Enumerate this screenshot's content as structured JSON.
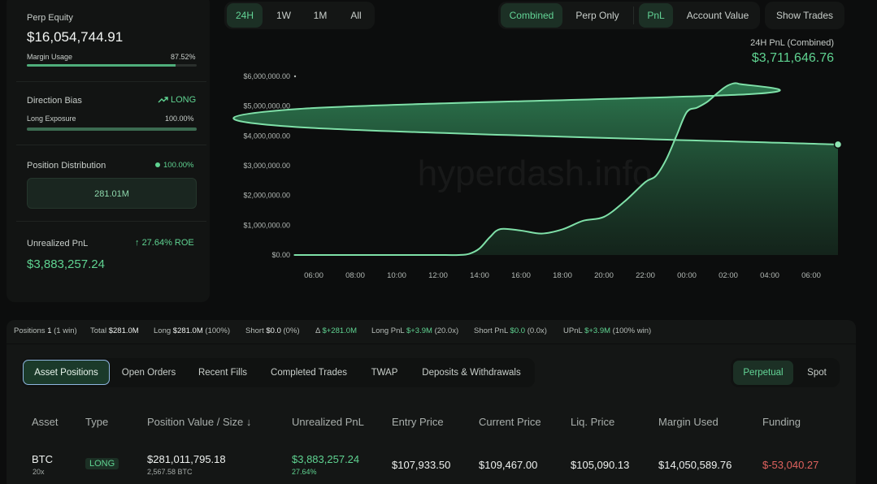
{
  "summary": {
    "perp_equity_label": "Perp Equity",
    "perp_equity_value": "$16,054,744.91",
    "margin_usage_label": "Margin Usage",
    "margin_usage_value": "87.52%",
    "margin_usage_fraction": 0.8752,
    "direction_bias_label": "Direction Bias",
    "direction_bias_value": "LONG",
    "long_exposure_label": "Long Exposure",
    "long_exposure_value": "100.00%",
    "long_exposure_fraction": 1.0,
    "position_distribution_label": "Position Distribution",
    "position_distribution_value": "100.00%",
    "position_distribution_amount": "281.01M",
    "unrealized_pnl_label": "Unrealized PnL",
    "unrealized_pnl_roe": "27.64% ROE",
    "unrealized_pnl_value": "$3,883,257.24"
  },
  "timeframes": [
    "24H",
    "1W",
    "1M",
    "All"
  ],
  "timeframe_selected": "24H",
  "mode": {
    "combined": "Combined",
    "perp_only": "Perp Only"
  },
  "metric": {
    "pnl": "PnL",
    "account_value": "Account Value"
  },
  "show_trades": "Show Trades",
  "pnl_header": {
    "label": "24H PnL (Combined)",
    "value": "$3,711,646.76"
  },
  "watermark": "hyperdash.info",
  "colors": {
    "accent": "#5fd391",
    "negative": "#e0625e",
    "active_bg": "#1c3025"
  },
  "chart_data": {
    "type": "area",
    "x": [
      "04:00",
      "05:00",
      "06:00",
      "07:00",
      "08:00",
      "09:00",
      "10:00",
      "11:00",
      "12:00",
      "13:00",
      "13:30",
      "14:00",
      "14:30",
      "15:00",
      "16:00",
      "17:00",
      "18:00",
      "19:00",
      "20:00",
      "21:00",
      "22:00",
      "22:30",
      "23:00",
      "23:30",
      "00:00",
      "00:30",
      "01:00",
      "01:30",
      "02:00",
      "02:30",
      "03:00",
      "04:00",
      "05:00",
      "05:45"
    ],
    "series": [
      {
        "values": [
          0,
          0,
          0,
          0,
          0,
          0,
          0,
          0,
          0,
          0,
          40000,
          220000,
          600000,
          870000,
          820000,
          720000,
          860000,
          1150000,
          1280000,
          1800000,
          2450000,
          2650000,
          3200000,
          4000000,
          4800000,
          4950000,
          5150000,
          5450000,
          5700000,
          5750000,
          5400000,
          4900000,
          4300000,
          3711646.76
        ]
      }
    ],
    "y_ticks": [
      "$6,000,000.00",
      "$5,000,000.00",
      "$4,000,000.00",
      "$3,000,000.00",
      "$2,000,000.00",
      "$1,000,000.00",
      "$0.00"
    ],
    "x_ticks": [
      "06:00",
      "08:00",
      "10:00",
      "12:00",
      "14:00",
      "16:00",
      "18:00",
      "20:00",
      "22:00",
      "00:00",
      "02:00",
      "04:00",
      "06:00"
    ],
    "ylim": [
      0,
      6000000
    ]
  },
  "stats": {
    "positions_label": "Positions",
    "positions_value": "1",
    "positions_win": "(1 win)",
    "total_label": "Total",
    "total_value": "$281.0M",
    "long_label": "Long",
    "long_value": "$281.0M",
    "long_pct": "(100%)",
    "short_label": "Short",
    "short_value": "$0.0",
    "short_pct": "(0%)",
    "delta_label": "Δ",
    "delta_value": "$+281.0M",
    "long_pnl_label": "Long PnL",
    "long_pnl_value": "$+3.9M",
    "long_pnl_x": "(20.0x)",
    "short_pnl_label": "Short PnL",
    "short_pnl_value": "$0.0",
    "short_pnl_x": "(0.0x)",
    "upnl_label": "UPnL",
    "upnl_value": "$+3.9M",
    "upnl_win": "(100% win)"
  },
  "tabs": [
    "Asset Positions",
    "Open Orders",
    "Recent Fills",
    "Completed Trades",
    "TWAP",
    "Deposits & Withdrawals"
  ],
  "market_tabs": [
    "Perpetual",
    "Spot"
  ],
  "table": {
    "headers": [
      "Asset",
      "Type",
      "Position Value / Size",
      "Unrealized PnL",
      "Entry Price",
      "Current Price",
      "Liq. Price",
      "Margin Used",
      "Funding"
    ],
    "sort_icon": "arrow-down-icon",
    "rows": [
      {
        "asset": "BTC",
        "leverage": "20x",
        "type": "LONG",
        "position_value": "$281,011,795.18",
        "size": "2,567.58 BTC",
        "unrealized_pnl": "$3,883,257.24",
        "unrealized_pct": "27.64%",
        "entry_price": "$107,933.50",
        "current_price": "$109,467.00",
        "liq_price": "$105,090.13",
        "margin_used": "$14,050,589.76",
        "funding": "$-53,040.27"
      }
    ]
  }
}
